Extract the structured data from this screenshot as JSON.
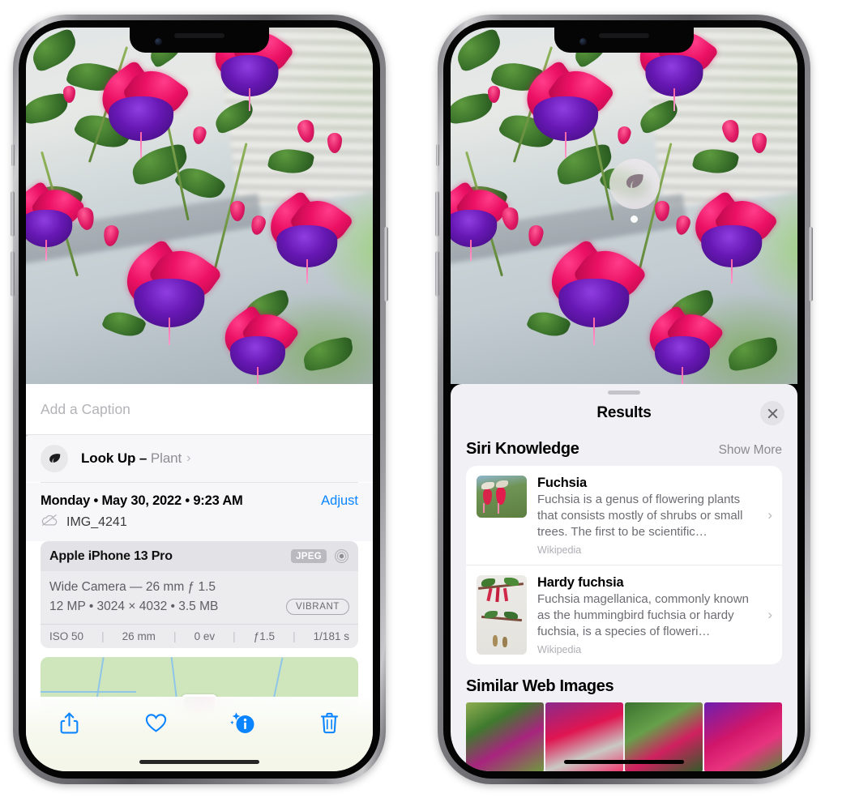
{
  "left_phone": {
    "name": "photos-info-screen",
    "caption_field": {
      "placeholder": "Add a Caption",
      "value": ""
    },
    "look_up": {
      "label": "Look Up",
      "dash": "–",
      "subject": "Plant",
      "icon": "leaf-icon",
      "chevron": "›"
    },
    "meta": {
      "date": "Monday • May 30, 2022 • 9:23 AM",
      "adjust_label": "Adjust",
      "filename": "IMG_4241",
      "filename_icon": "cloud-slash-icon"
    },
    "exif": {
      "model": "Apple iPhone 13 Pro",
      "format_badge": "JPEG",
      "lens_icon": "aperture-icon",
      "lens_line": "Wide Camera — 26 mm ƒ 1.5",
      "size_line": "12 MP • 3024 × 4032 • 3.5 MB",
      "style_badge": "VIBRANT",
      "stats": [
        "ISO 50",
        "26 mm",
        "0 ev",
        "ƒ1.5",
        "1/181 s"
      ]
    },
    "toolbar": [
      {
        "name": "share-button",
        "icon": "share-icon"
      },
      {
        "name": "favorite-button",
        "icon": "heart-icon"
      },
      {
        "name": "info-button",
        "icon": "info-sparkle-icon"
      },
      {
        "name": "delete-button",
        "icon": "trash-icon"
      }
    ],
    "accent_color": "#0a84ff"
  },
  "right_phone": {
    "name": "visual-look-up-results",
    "badge": {
      "icon": "leaf-icon",
      "name": "visual-look-up-badge"
    },
    "sheet": {
      "title": "Results",
      "close_icon": "close-icon",
      "siri_knowledge": {
        "title": "Siri Knowledge",
        "show_more": "Show More",
        "items": [
          {
            "name": "Fuchsia",
            "description": "Fuchsia is a genus of flowering plants that consists mostly of shrubs or small trees. The first to be scientific…",
            "source": "Wikipedia",
            "chevron": "›"
          },
          {
            "name": "Hardy fuchsia",
            "description": "Fuchsia magellanica, commonly known as the hummingbird fuchsia or hardy fuchsia, is a species of floweri…",
            "source": "Wikipedia",
            "chevron": "›"
          }
        ]
      },
      "similar_web_images": {
        "title": "Similar Web Images",
        "count": 4
      }
    }
  }
}
